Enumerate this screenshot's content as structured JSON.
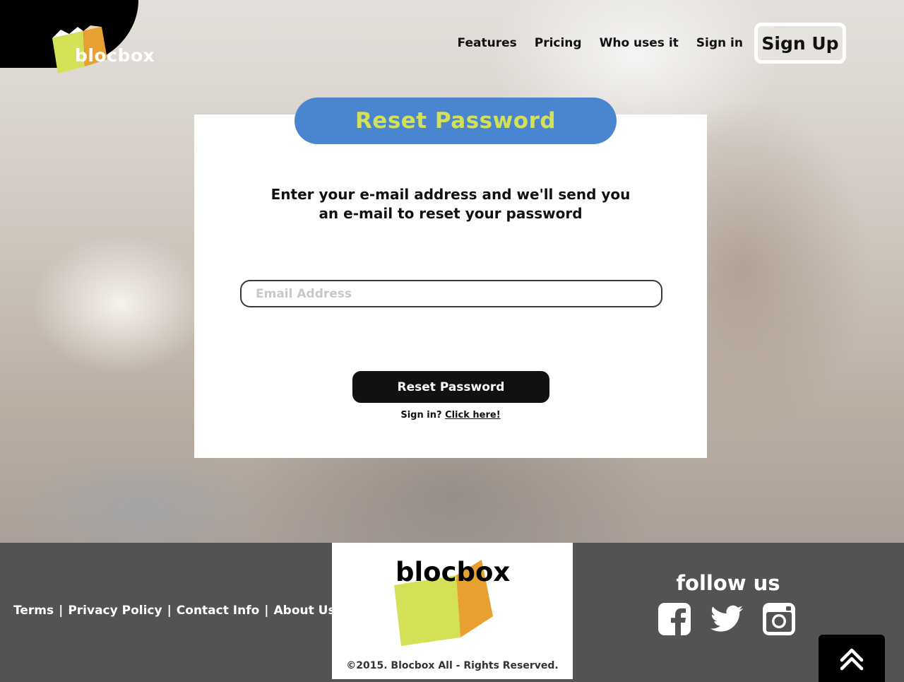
{
  "brand": {
    "name": "blocbox"
  },
  "nav": {
    "items": [
      {
        "label": "Features"
      },
      {
        "label": "Pricing"
      },
      {
        "label": "Who uses it"
      },
      {
        "label": "Sign in"
      }
    ],
    "signup_label": "Sign Up"
  },
  "card": {
    "title": "Reset Password",
    "instructions_line1": "Enter your e-mail address and we'll send you",
    "instructions_line2": "an e-mail to reset your password",
    "email_placeholder": "Email Address",
    "email_value": "",
    "button_label": "Reset Password",
    "signin_prompt": "Sign in?",
    "signin_link": "Click here!"
  },
  "footer": {
    "links": [
      {
        "label": "Terms"
      },
      {
        "label": "Privacy Policy"
      },
      {
        "label": "Contact Info"
      },
      {
        "label": "About Us"
      }
    ],
    "separator": "|",
    "brand": "blocbox",
    "copyright": "©2015. Blocbox All - Rights Reserved.",
    "follow_title": "follow us",
    "social_icons": [
      "facebook-icon",
      "twitter-icon",
      "instagram-icon"
    ]
  },
  "colors": {
    "accent_blue": "#4a86d0",
    "accent_lime": "#d4e157",
    "accent_orange": "#e8a030",
    "dark": "#111111",
    "footer_gray": "#535353"
  }
}
